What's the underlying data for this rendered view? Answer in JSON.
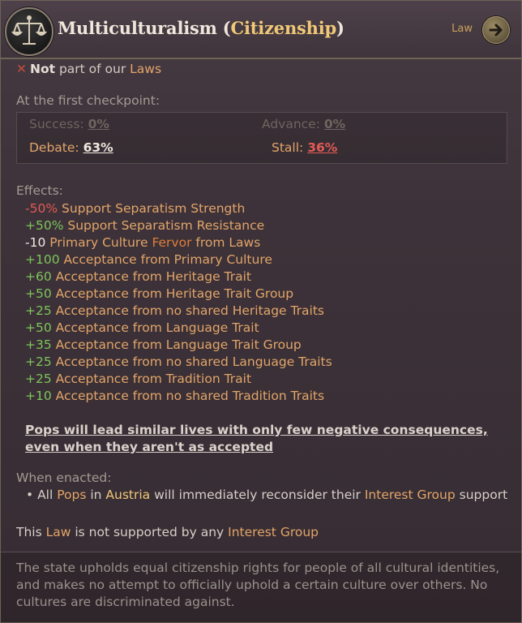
{
  "header": {
    "icon": "scales-of-justice-icon",
    "title_main": "Multiculturalism",
    "title_open": " (",
    "title_highlight": "Citizenship",
    "title_close": ")",
    "law_link": "Law",
    "arrow_icon": "arrow-right-icon"
  },
  "status": {
    "icon": "cross-icon",
    "not": "Not",
    "text": " part of our ",
    "laws": "Laws"
  },
  "checkpoint": {
    "label": "At the first checkpoint:",
    "success_label": "Success:",
    "success_value": "0%",
    "advance_label": "Advance:",
    "advance_value": "0%",
    "debate_label": "Debate:",
    "debate_value": "63%",
    "stall_label": "Stall:",
    "stall_value": "36%"
  },
  "effects": {
    "label": "Effects:",
    "items": [
      {
        "value": "-50%",
        "text": " Support Separatism Strength"
      },
      {
        "value": "+50%",
        "text": " Support Separatism Resistance"
      },
      {
        "value": "-10",
        "text_a": " Primary Culture ",
        "highlight": "Fervor",
        "text_b": " from Laws"
      },
      {
        "value": "+100",
        "text": " Acceptance from Primary Culture"
      },
      {
        "value": "+60",
        "text": " Acceptance from Heritage Trait"
      },
      {
        "value": "+50",
        "text": " Acceptance from Heritage Trait Group"
      },
      {
        "value": "+25",
        "text": " Acceptance from no shared Heritage Traits"
      },
      {
        "value": "+50",
        "text": " Acceptance from Language Trait"
      },
      {
        "value": "+35",
        "text": " Acceptance from Language Trait Group"
      },
      {
        "value": "+25",
        "text": " Acceptance from no shared Language Traits"
      },
      {
        "value": "+25",
        "text": " Acceptance from Tradition Trait"
      },
      {
        "value": "+10",
        "text": " Acceptance from no shared Tradition Traits"
      }
    ]
  },
  "summary": "Pops will lead similar lives with only few negative consequences, even when they aren't as accepted",
  "enacted": {
    "label": "When enacted:",
    "bullet": "•",
    "t1": " All ",
    "pops": "Pops",
    "t2": " in ",
    "country": "Austria",
    "t3": " will immediately reconsider their ",
    "ig": "Interest Group",
    "t4": " support"
  },
  "support": {
    "t1": "This ",
    "law": "Law",
    "t2": " is not supported by any ",
    "ig": "Interest Group"
  },
  "flavor": "The state upholds equal citizenship rights for people of all cultural identities, and makes no attempt to officially uphold a certain culture over others. No cultures are discriminated against.",
  "colors": {
    "positive": "#7ec55b",
    "negative": "#e35a54",
    "highlight": "#e2a569",
    "title_highlight": "#f0c878"
  }
}
